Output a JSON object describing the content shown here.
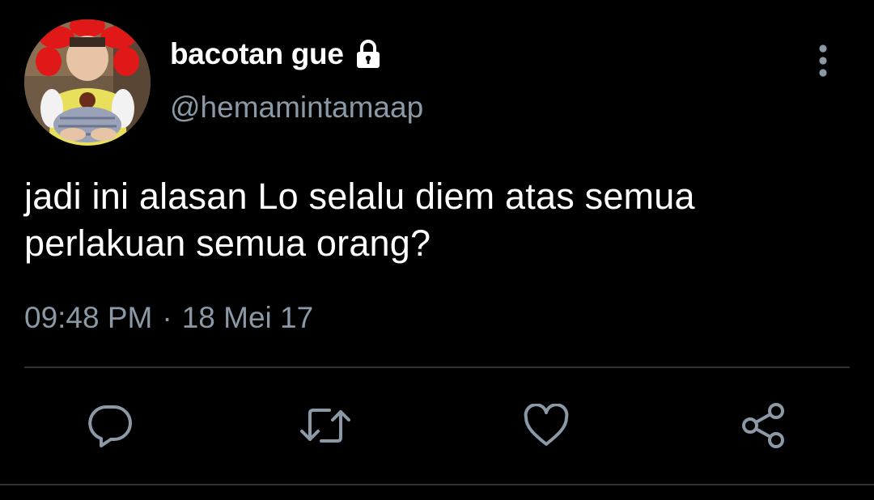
{
  "tweet": {
    "display_name": "bacotan gue",
    "handle": "@hemamintamaap",
    "text_line_1": "jadi ini alasan Lo selalu diem atas semua",
    "text_line_2": "perlakuan semua orang?",
    "time": "09:48 PM",
    "separator": "·",
    "date": "18 Mei 17"
  },
  "icons": {
    "lock": "lock-icon",
    "more": "more-vertical-icon",
    "reply": "reply-icon",
    "retweet": "retweet-icon",
    "like": "heart-icon",
    "share": "share-icon"
  },
  "colors": {
    "background": "#000000",
    "text": "#ffffff",
    "secondary": "#8b98a5",
    "divider": "#2f3336"
  }
}
